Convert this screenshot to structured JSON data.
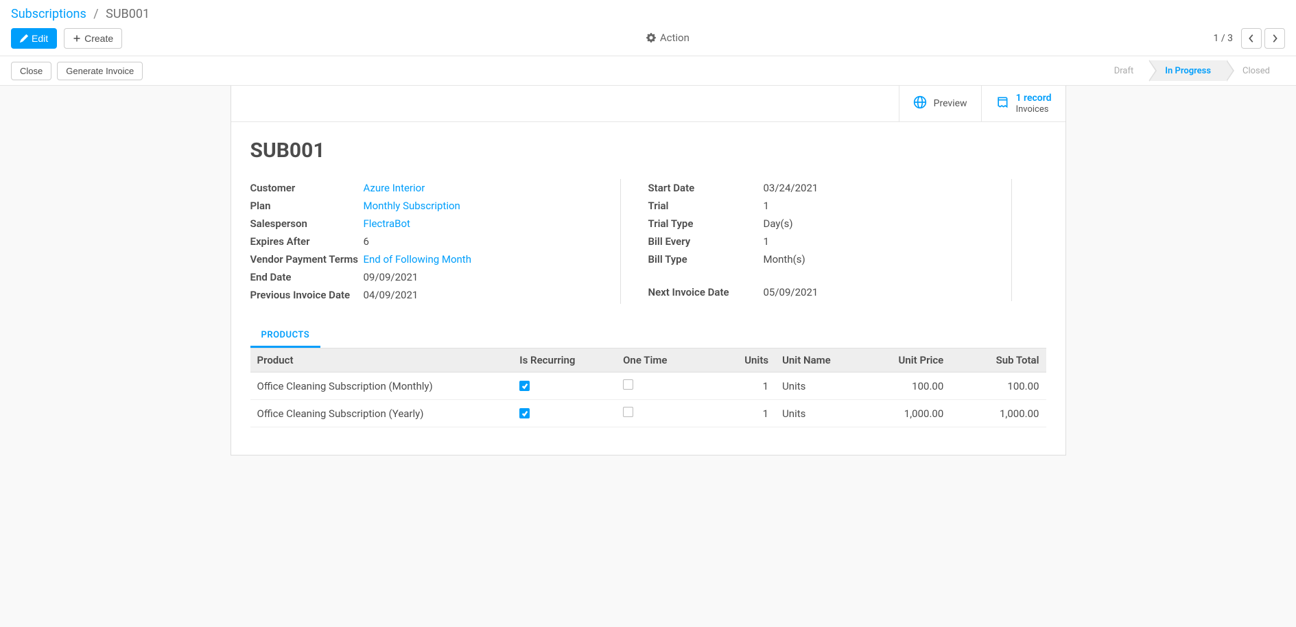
{
  "breadcrumb": {
    "root": "Subscriptions",
    "current": "SUB001"
  },
  "toolbar": {
    "edit": "Edit",
    "create": "Create",
    "action": "Action"
  },
  "pager": {
    "count": "1 / 3"
  },
  "statusbar": {
    "close": "Close",
    "generate": "Generate Invoice",
    "steps": {
      "draft": "Draft",
      "progress": "In Progress",
      "closed": "Closed"
    }
  },
  "sheetButtons": {
    "preview": "Preview",
    "invoices_top": "1 record",
    "invoices_bot": "Invoices"
  },
  "record": {
    "title": "SUB001",
    "left": {
      "customer_label": "Customer",
      "customer_value": "Azure Interior",
      "plan_label": "Plan",
      "plan_value": "Monthly Subscription",
      "salesperson_label": "Salesperson",
      "salesperson_value": "FlectraBot",
      "expires_label": "Expires After",
      "expires_value": "6",
      "terms_label": "Vendor Payment Terms",
      "terms_value": "End of Following Month",
      "enddate_label": "End Date",
      "enddate_value": "09/09/2021",
      "prevdate_label": "Previous Invoice Date",
      "prevdate_value": "04/09/2021"
    },
    "right": {
      "start_label": "Start Date",
      "start_value": "03/24/2021",
      "trial_label": "Trial",
      "trial_value": "1",
      "trialtype_label": "Trial Type",
      "trialtype_value": "Day(s)",
      "billevery_label": "Bill Every",
      "billevery_value": "1",
      "billtype_label": "Bill Type",
      "billtype_value": "Month(s)",
      "nextdate_label": "Next Invoice Date",
      "nextdate_value": "05/09/2021"
    }
  },
  "tabs": {
    "products": "PRODUCTS"
  },
  "table": {
    "headers": {
      "product": "Product",
      "recurring": "Is Recurring",
      "onetime": "One Time",
      "units": "Units",
      "unitname": "Unit Name",
      "unitprice": "Unit Price",
      "subtotal": "Sub Total"
    },
    "rows": [
      {
        "product": "Office Cleaning Subscription (Monthly)",
        "recurring": true,
        "onetime": false,
        "units": "1",
        "unitname": "Units",
        "unitprice": "100.00",
        "subtotal": "100.00"
      },
      {
        "product": "Office Cleaning Subscription (Yearly)",
        "recurring": true,
        "onetime": false,
        "units": "1",
        "unitname": "Units",
        "unitprice": "1,000.00",
        "subtotal": "1,000.00"
      }
    ]
  }
}
